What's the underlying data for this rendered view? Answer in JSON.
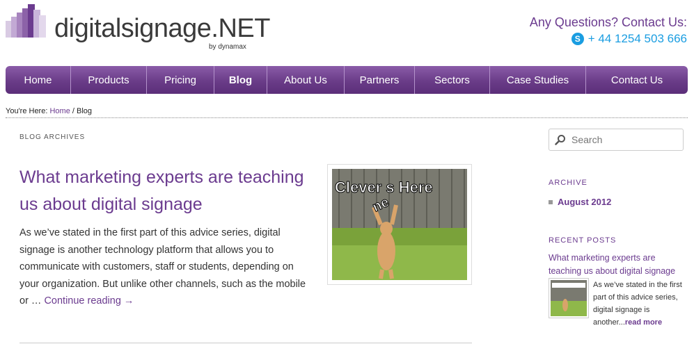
{
  "header": {
    "logo_text": "digitalsignage.NET",
    "logo_sub": "by dynamax",
    "contact_title": "Any Questions? Contact Us:",
    "contact_phone": "+ 44 1254 503 666"
  },
  "nav": {
    "items": [
      {
        "label": "Home"
      },
      {
        "label": "Products"
      },
      {
        "label": "Pricing"
      },
      {
        "label": "Blog"
      },
      {
        "label": "About Us"
      },
      {
        "label": "Partners"
      },
      {
        "label": "Sectors"
      },
      {
        "label": "Case Studies"
      },
      {
        "label": "Contact Us"
      }
    ],
    "active": "Blog"
  },
  "breadcrumb": {
    "prefix": "You're Here:",
    "home": "Home",
    "separator": "/",
    "current": "Blog"
  },
  "main": {
    "archive_label": "BLOG ARCHIVES",
    "post_title": "What marketing experts are teaching us about digital signage",
    "post_excerpt": "As we’ve stated in the first part of this advice series, digital signage is another technology platform that allows you to communicate with customers, staff or students, depending on your organization. But unlike other channels, such as the mobile or …",
    "continue_label": "Continue reading →",
    "image_caption": "Clever s Here",
    "image_letters": "ne"
  },
  "sidebar": {
    "search_placeholder": "Search",
    "archive_title": "ARCHIVE",
    "archive_items": [
      {
        "label": "August 2012"
      }
    ],
    "recent_title": "RECENT POSTS",
    "recent_post_title": "What marketing experts are teaching us about digital signage",
    "recent_post_excerpt": "As we’ve stated in the first part of this advice series, digital signage is another...",
    "read_more": "read more"
  },
  "colors": {
    "brand_purple": "#6b3b8f",
    "link_blue": "#1a9de1"
  }
}
